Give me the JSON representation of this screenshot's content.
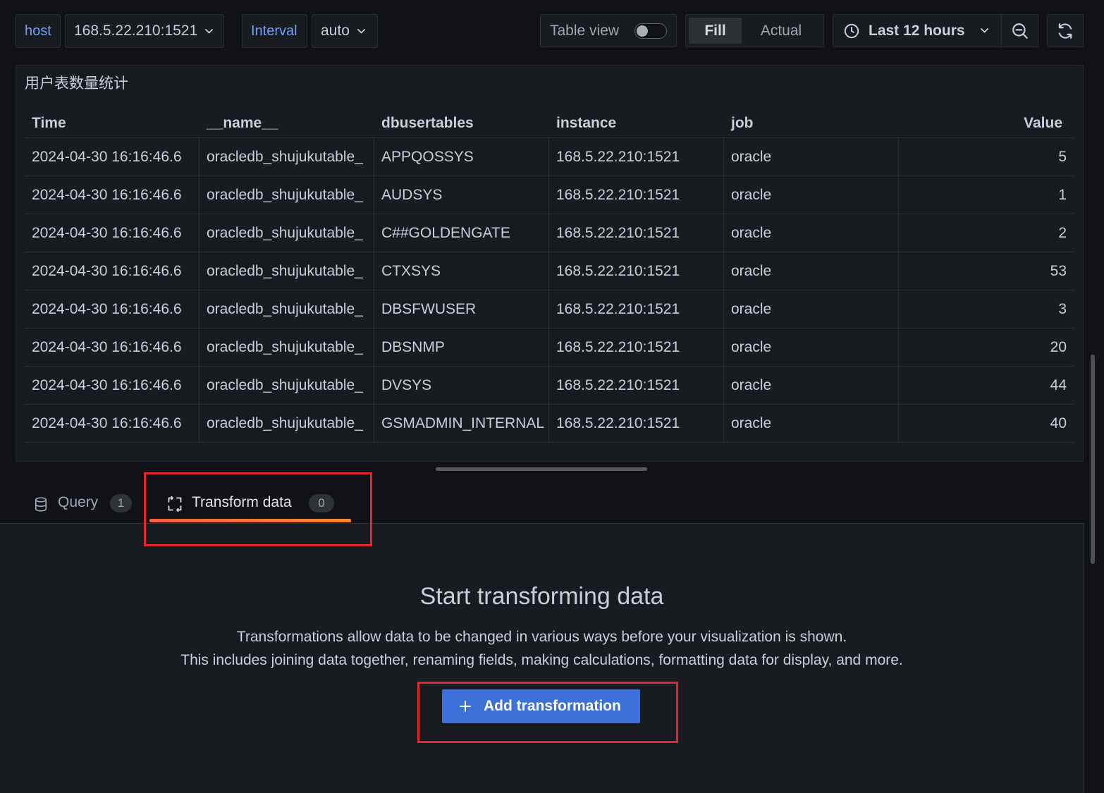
{
  "toolbar": {
    "host": {
      "label": "host",
      "value": "168.5.22.210:1521"
    },
    "interval": {
      "label": "Interval",
      "value": "auto"
    },
    "table_view": {
      "label": "Table view",
      "enabled": false
    },
    "fill_mode": {
      "options": [
        "Fill",
        "Actual"
      ],
      "selected_index": 0
    },
    "time_range": {
      "label": "Last 12 hours",
      "icon": "clock-icon"
    },
    "zoom_out": {
      "icon": "zoom-out-icon"
    },
    "refresh": {
      "icon": "refresh-icon"
    }
  },
  "panel": {
    "title": "用户表数量统计",
    "columns": {
      "time": "Time",
      "name": "__name__",
      "dbusertables": "dbusertables",
      "instance": "instance",
      "job": "job",
      "value": "Value"
    },
    "rows": [
      {
        "time": "2024-04-30 16:16:46.6",
        "name": "oracledb_shujukutable_",
        "dbusertables": "APPQOSSYS",
        "instance": "168.5.22.210:1521",
        "job": "oracle",
        "value": 5
      },
      {
        "time": "2024-04-30 16:16:46.6",
        "name": "oracledb_shujukutable_",
        "dbusertables": "AUDSYS",
        "instance": "168.5.22.210:1521",
        "job": "oracle",
        "value": 1
      },
      {
        "time": "2024-04-30 16:16:46.6",
        "name": "oracledb_shujukutable_",
        "dbusertables": "C##GOLDENGATE",
        "instance": "168.5.22.210:1521",
        "job": "oracle",
        "value": 2
      },
      {
        "time": "2024-04-30 16:16:46.6",
        "name": "oracledb_shujukutable_",
        "dbusertables": "CTXSYS",
        "instance": "168.5.22.210:1521",
        "job": "oracle",
        "value": 53
      },
      {
        "time": "2024-04-30 16:16:46.6",
        "name": "oracledb_shujukutable_",
        "dbusertables": "DBSFWUSER",
        "instance": "168.5.22.210:1521",
        "job": "oracle",
        "value": 3
      },
      {
        "time": "2024-04-30 16:16:46.6",
        "name": "oracledb_shujukutable_",
        "dbusertables": "DBSNMP",
        "instance": "168.5.22.210:1521",
        "job": "oracle",
        "value": 20
      },
      {
        "time": "2024-04-30 16:16:46.6",
        "name": "oracledb_shujukutable_",
        "dbusertables": "DVSYS",
        "instance": "168.5.22.210:1521",
        "job": "oracle",
        "value": 44
      },
      {
        "time": "2024-04-30 16:16:46.6",
        "name": "oracledb_shujukutable_",
        "dbusertables": "GSMADMIN_INTERNAL",
        "instance": "168.5.22.210:1521",
        "job": "oracle",
        "value": 40
      }
    ]
  },
  "editor_tabs": [
    {
      "label": "Query",
      "count": 1,
      "icon": "database-icon",
      "active": false
    },
    {
      "label": "Transform data",
      "count": 0,
      "icon": "transform-icon",
      "active": true
    }
  ],
  "transformations_empty": {
    "heading": "Start transforming data",
    "description": [
      "Transformations allow data to be changed in various ways before your visualization is shown.",
      "This includes joining data together, renaming fields, making calculations, formatting data for display, and more."
    ],
    "add_button": {
      "label": "Add transformation",
      "icon": "plus-icon"
    }
  },
  "colors": {
    "bg": "#111217",
    "panel": "#181b1f",
    "text": "#ccccdc",
    "muted": "#9fa7b3",
    "label": "#6e9fff",
    "primary": "#3d71d9",
    "underline": "#ff8833",
    "highlight": "#e3262b"
  }
}
